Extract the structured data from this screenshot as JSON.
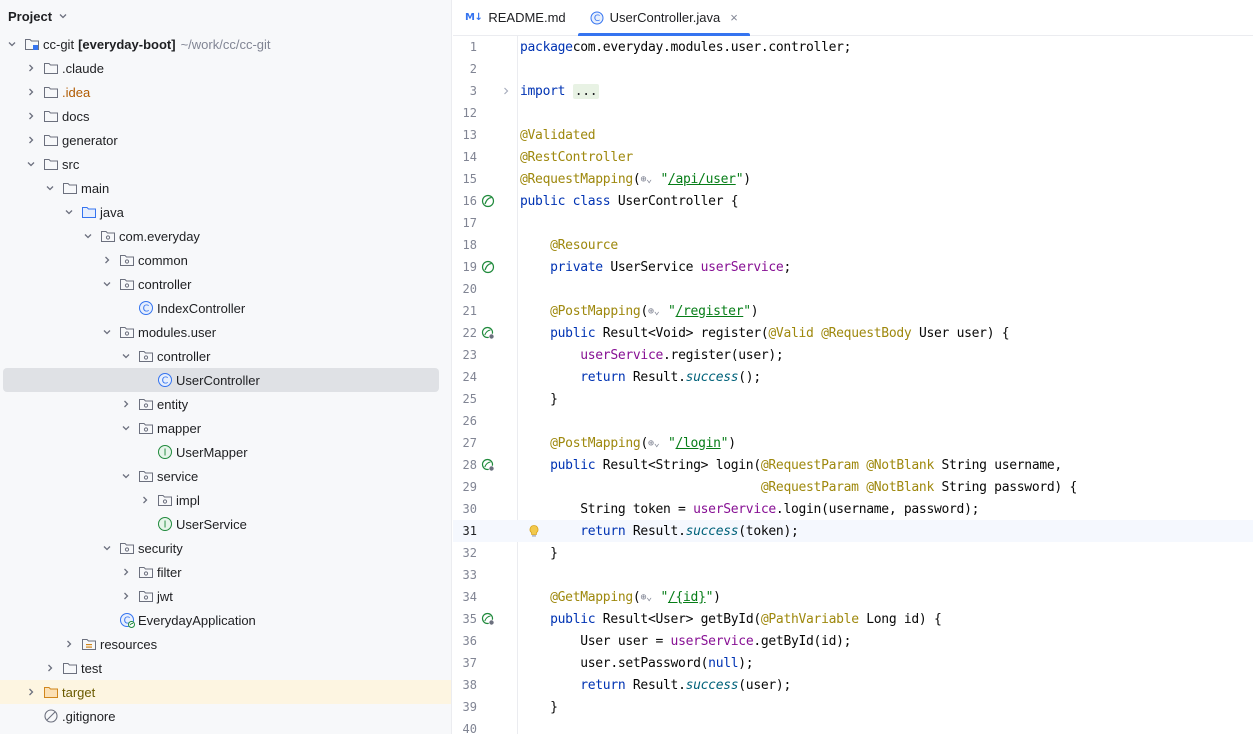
{
  "project_panel": {
    "title": "Project",
    "tree": [
      {
        "label": "cc-git",
        "extra": "[everyday-boot]",
        "path": "~/work/cc/cc-git",
        "depth": 0,
        "arrow": "down",
        "icon": "module-folder"
      },
      {
        "label": ".claude",
        "depth": 1,
        "arrow": "right",
        "icon": "folder"
      },
      {
        "label": ".idea",
        "depth": 1,
        "arrow": "right",
        "icon": "folder",
        "style": "orange"
      },
      {
        "label": "docs",
        "depth": 1,
        "arrow": "right",
        "icon": "folder"
      },
      {
        "label": "generator",
        "depth": 1,
        "arrow": "right",
        "icon": "folder"
      },
      {
        "label": "src",
        "depth": 1,
        "arrow": "down",
        "icon": "folder"
      },
      {
        "label": "main",
        "depth": 2,
        "arrow": "down",
        "icon": "folder"
      },
      {
        "label": "java",
        "depth": 3,
        "arrow": "down",
        "icon": "source-folder"
      },
      {
        "label": "com.everyday",
        "depth": 4,
        "arrow": "down",
        "icon": "package"
      },
      {
        "label": "common",
        "depth": 5,
        "arrow": "right",
        "icon": "package"
      },
      {
        "label": "controller",
        "depth": 5,
        "arrow": "down",
        "icon": "package"
      },
      {
        "label": "IndexController",
        "depth": 6,
        "arrow": "none",
        "icon": "class"
      },
      {
        "label": "modules.user",
        "depth": 5,
        "arrow": "down",
        "icon": "package"
      },
      {
        "label": "controller",
        "depth": 6,
        "arrow": "down",
        "icon": "package"
      },
      {
        "label": "UserController",
        "depth": 7,
        "arrow": "none",
        "icon": "class",
        "selected": true
      },
      {
        "label": "entity",
        "depth": 6,
        "arrow": "right",
        "icon": "package"
      },
      {
        "label": "mapper",
        "depth": 6,
        "arrow": "down",
        "icon": "package"
      },
      {
        "label": "UserMapper",
        "depth": 7,
        "arrow": "none",
        "icon": "interface"
      },
      {
        "label": "service",
        "depth": 6,
        "arrow": "down",
        "icon": "package"
      },
      {
        "label": "impl",
        "depth": 7,
        "arrow": "right",
        "icon": "package"
      },
      {
        "label": "UserService",
        "depth": 7,
        "arrow": "none",
        "icon": "interface"
      },
      {
        "label": "security",
        "depth": 5,
        "arrow": "down",
        "icon": "package"
      },
      {
        "label": "filter",
        "depth": 6,
        "arrow": "right",
        "icon": "package"
      },
      {
        "label": "jwt",
        "depth": 6,
        "arrow": "right",
        "icon": "package"
      },
      {
        "label": "EverydayApplication",
        "depth": 5,
        "arrow": "none",
        "icon": "spring-class"
      },
      {
        "label": "resources",
        "depth": 3,
        "arrow": "right",
        "icon": "resources-folder"
      },
      {
        "label": "test",
        "depth": 2,
        "arrow": "right",
        "icon": "folder"
      },
      {
        "label": "target",
        "depth": 1,
        "arrow": "right",
        "icon": "excluded-folder",
        "highlight": true,
        "style": "olive"
      },
      {
        "label": ".gitignore",
        "depth": 1,
        "arrow": "none",
        "icon": "ignore-file"
      }
    ]
  },
  "editor": {
    "tabs": [
      {
        "label": "README.md",
        "icon": "markdown-icon",
        "active": false
      },
      {
        "label": "UserController.java",
        "icon": "class-icon",
        "active": true,
        "close": "×"
      }
    ],
    "current_line": 31,
    "lines": [
      {
        "n": "1",
        "tokens": [
          [
            "kw",
            "package"
          ],
          [
            "",
            "com.everyday.modules.user.controller;"
          ]
        ]
      },
      {
        "n": "2",
        "tokens": []
      },
      {
        "n": "3",
        "tokens": [
          [
            "kw",
            "import"
          ],
          [
            "",
            ""
          ],
          [
            "fold",
            "..."
          ]
        ],
        "gutter": "fold"
      },
      {
        "n": "12",
        "tokens": []
      },
      {
        "n": "13",
        "tokens": [
          [
            "an",
            "@Validated"
          ]
        ]
      },
      {
        "n": "14",
        "tokens": [
          [
            "an",
            "@RestController"
          ]
        ]
      },
      {
        "n": "15",
        "tokens": [
          [
            "an",
            "@RequestMapping"
          ],
          [
            "",
            "("
          ],
          [
            "globe",
            "⊕⌄"
          ],
          [
            "str",
            "\""
          ],
          [
            "url",
            "/api/user"
          ],
          [
            "str",
            "\""
          ],
          [
            "",
            ")"
          ]
        ]
      },
      {
        "n": "16",
        "tokens": [
          [
            "kw",
            "public class "
          ],
          [
            "",
            "UserController {"
          ]
        ],
        "gutter": "bean"
      },
      {
        "n": "17",
        "tokens": []
      },
      {
        "n": "19",
        "tokens": [
          [
            "",
            "    "
          ],
          [
            "an",
            "@Resource"
          ]
        ],
        "display_n": "18"
      },
      {
        "n": "19",
        "tokens": [
          [
            "",
            "    "
          ],
          [
            "kw",
            "private "
          ],
          [
            "",
            "UserService "
          ],
          [
            "fld",
            "userService"
          ],
          [
            "",
            ";"
          ]
        ],
        "gutter": "bean"
      },
      {
        "n": "20",
        "tokens": []
      },
      {
        "n": "21",
        "tokens": [
          [
            "",
            "    "
          ],
          [
            "an",
            "@PostMapping"
          ],
          [
            "",
            "("
          ],
          [
            "globe",
            "⊕⌄"
          ],
          [
            "str",
            "\""
          ],
          [
            "url",
            "/register"
          ],
          [
            "str",
            "\""
          ],
          [
            "",
            ")"
          ]
        ]
      },
      {
        "n": "22",
        "tokens": [
          [
            "",
            "    "
          ],
          [
            "kw",
            "public "
          ],
          [
            "",
            "Result<Void> "
          ],
          [
            "it2",
            "register"
          ],
          [
            "",
            "("
          ],
          [
            "an",
            "@Valid @RequestBody "
          ],
          [
            "",
            "User user) {"
          ]
        ],
        "gutter": "endpoint"
      },
      {
        "n": "23",
        "tokens": [
          [
            "",
            "        "
          ],
          [
            "fld",
            "userService"
          ],
          [
            "",
            ".register(user);"
          ]
        ]
      },
      {
        "n": "24",
        "tokens": [
          [
            "",
            "        "
          ],
          [
            "kw",
            "return "
          ],
          [
            "",
            "Result."
          ],
          [
            "it",
            "success"
          ],
          [
            "",
            "();"
          ]
        ]
      },
      {
        "n": "25",
        "tokens": [
          [
            "",
            "    }"
          ]
        ]
      },
      {
        "n": "26",
        "tokens": []
      },
      {
        "n": "27",
        "tokens": [
          [
            "",
            "    "
          ],
          [
            "an",
            "@PostMapping"
          ],
          [
            "",
            "("
          ],
          [
            "globe",
            "⊕⌄"
          ],
          [
            "str",
            "\""
          ],
          [
            "url",
            "/login"
          ],
          [
            "str",
            "\""
          ],
          [
            "",
            ")"
          ]
        ]
      },
      {
        "n": "28",
        "tokens": [
          [
            "",
            "    "
          ],
          [
            "kw",
            "public "
          ],
          [
            "",
            "Result<String> "
          ],
          [
            "it2",
            "login"
          ],
          [
            "",
            "("
          ],
          [
            "an",
            "@RequestParam @NotBlank "
          ],
          [
            "",
            "String username,"
          ]
        ],
        "gutter": "endpoint"
      },
      {
        "n": "29",
        "tokens": [
          [
            "",
            "                                "
          ],
          [
            "an",
            "@RequestParam @NotBlank "
          ],
          [
            "",
            "String password) {"
          ]
        ]
      },
      {
        "n": "30",
        "tokens": [
          [
            "",
            "        String token = "
          ],
          [
            "fld",
            "userService"
          ],
          [
            "",
            ".login(username, password);"
          ]
        ]
      },
      {
        "n": "31",
        "tokens": [
          [
            "",
            "        "
          ],
          [
            "kw",
            "return "
          ],
          [
            "",
            "Result."
          ],
          [
            "it",
            "success"
          ],
          [
            "",
            "(token);"
          ]
        ],
        "gutter": "bulb"
      },
      {
        "n": "32",
        "tokens": [
          [
            "",
            "    }"
          ]
        ]
      },
      {
        "n": "33",
        "tokens": []
      },
      {
        "n": "34",
        "tokens": [
          [
            "",
            "    "
          ],
          [
            "an",
            "@GetMapping"
          ],
          [
            "",
            "("
          ],
          [
            "globe",
            "⊕⌄"
          ],
          [
            "str",
            "\""
          ],
          [
            "url",
            "/{id}"
          ],
          [
            "str",
            "\""
          ],
          [
            "",
            ")"
          ]
        ]
      },
      {
        "n": "35",
        "tokens": [
          [
            "",
            "    "
          ],
          [
            "kw",
            "public "
          ],
          [
            "",
            "Result<User> "
          ],
          [
            "it2",
            "getById"
          ],
          [
            "",
            "("
          ],
          [
            "an",
            "@PathVariable "
          ],
          [
            "",
            "Long id) {"
          ]
        ],
        "gutter": "endpoint"
      },
      {
        "n": "36",
        "tokens": [
          [
            "",
            "        User user = "
          ],
          [
            "fld",
            "userService"
          ],
          [
            "",
            ".getById(id);"
          ]
        ]
      },
      {
        "n": "37",
        "tokens": [
          [
            "",
            "        user.setPassword("
          ],
          [
            "kw",
            "null"
          ],
          [
            "",
            ");"
          ]
        ]
      },
      {
        "n": "38",
        "tokens": [
          [
            "",
            "        "
          ],
          [
            "kw",
            "return "
          ],
          [
            "",
            "Result."
          ],
          [
            "it",
            "success"
          ],
          [
            "",
            "(user);"
          ]
        ]
      },
      {
        "n": "39",
        "tokens": [
          [
            "",
            "    }"
          ]
        ]
      },
      {
        "n": "40",
        "tokens": []
      }
    ]
  },
  "colors": {
    "accent": "#3574f0",
    "selection": "#dfe1e5",
    "highlight_row": "#fdf5e1",
    "keyword": "#0033b3",
    "annotation": "#9e880d",
    "string": "#067d17",
    "field": "#871094"
  }
}
